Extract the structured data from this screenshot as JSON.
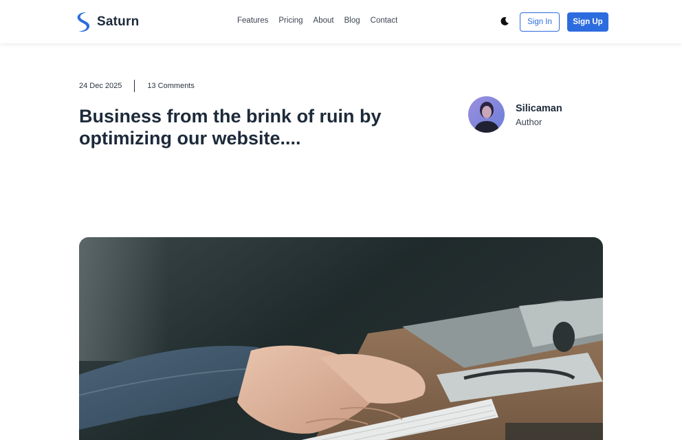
{
  "brand": {
    "name": "Saturn",
    "accent": "#2d6cdf",
    "logo_icon": "saturn-s-logo-icon"
  },
  "nav": {
    "items": [
      {
        "label": "Features"
      },
      {
        "label": "Pricing"
      },
      {
        "label": "About"
      },
      {
        "label": "Blog"
      },
      {
        "label": "Contact"
      }
    ]
  },
  "header_actions": {
    "theme_icon": "moon-icon",
    "sign_in_label": "Sign In",
    "sign_up_label": "Sign Up"
  },
  "post": {
    "date": "24 Dec 2025",
    "comments": "13 Comments",
    "title": "Business from the brink of ruin by optimizing our website...."
  },
  "author": {
    "name": "Silicaman",
    "role": "Author"
  },
  "colors": {
    "text_dark": "#1d2a3a",
    "primary": "#2d6cdf"
  }
}
